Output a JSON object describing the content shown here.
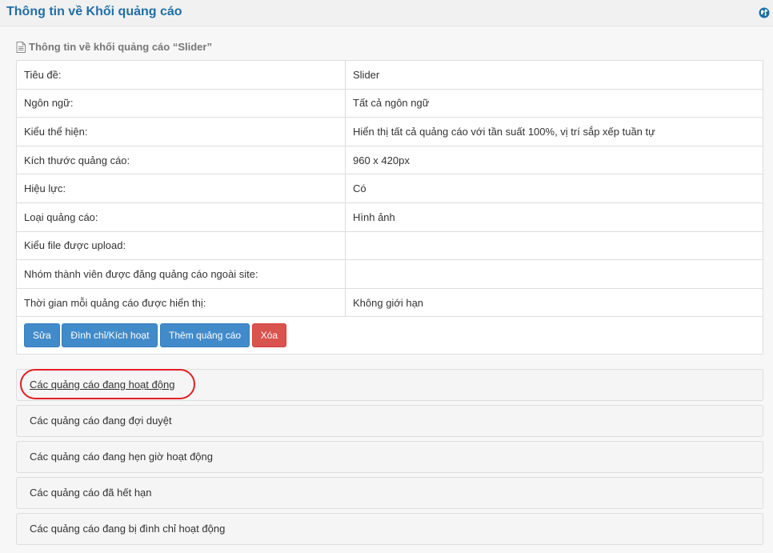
{
  "header": {
    "title": "Thông tin về Khối quảng cáo",
    "icon": "globe-icon"
  },
  "info": {
    "title": "Thông tin về khối quảng cáo “Slider”",
    "rows": [
      {
        "label": "Tiêu đề:",
        "value": "Slider"
      },
      {
        "label": "Ngôn ngữ:",
        "value": "Tất cả ngôn ngữ"
      },
      {
        "label": "Kiểu thể hiện:",
        "value": "Hiển thị tất cả quảng cáo với tần suất 100%, vị trí sắp xếp tuần tự"
      },
      {
        "label": "Kích thước quảng cáo:",
        "value": "960 x 420px"
      },
      {
        "label": "Hiệu lực:",
        "value": "Có"
      },
      {
        "label": "Loại quảng cáo:",
        "value": "Hình ảnh"
      },
      {
        "label": "Kiểu file được upload:",
        "value": ""
      },
      {
        "label": "Nhóm thành viên được đăng quảng cáo ngoài site:",
        "value": ""
      },
      {
        "label": "Thời gian mỗi quảng cáo được hiển thị:",
        "value": "Không giới hạn"
      }
    ]
  },
  "buttons": {
    "edit": "Sửa",
    "suspend": "Đình chỉ/Kích hoạt",
    "add": "Thêm quảng cáo",
    "delete": "Xóa"
  },
  "accordion": [
    {
      "label": "Các quảng cáo đang hoạt động"
    },
    {
      "label": "Các quảng cáo đang đợi duyệt"
    },
    {
      "label": "Các quảng cáo đang hẹn giờ hoạt động"
    },
    {
      "label": "Các quảng cáo đã hết hạn"
    },
    {
      "label": "Các quảng cáo đang bị đình chỉ hoạt động"
    }
  ],
  "colors": {
    "title_blue": "#1f6fa6",
    "primary": "#428bca",
    "danger": "#d9534f",
    "highlight": "#e31e24"
  }
}
